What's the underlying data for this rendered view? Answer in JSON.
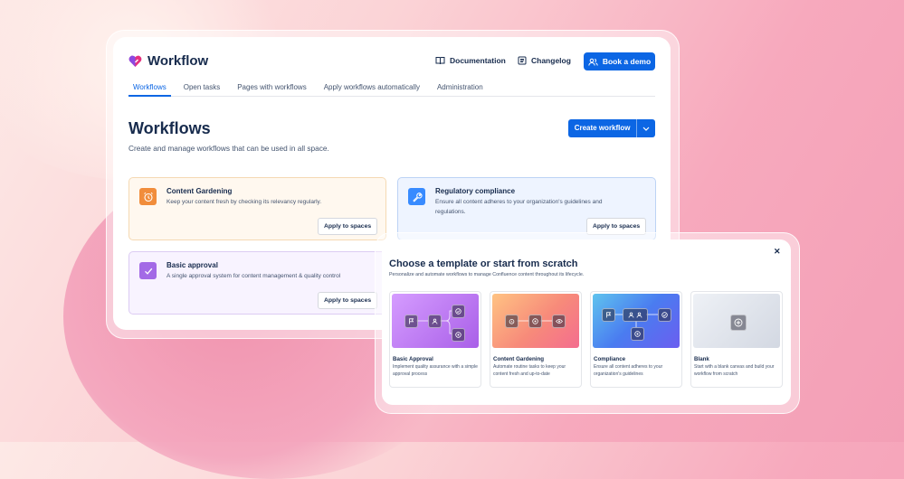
{
  "app": {
    "name": "Workflow"
  },
  "header": {
    "documentation": "Documentation",
    "changelog": "Changelog",
    "book_demo": "Book a demo"
  },
  "tabs": [
    {
      "label": "Workflows",
      "active": true
    },
    {
      "label": "Open tasks"
    },
    {
      "label": "Pages with workflows"
    },
    {
      "label": "Apply workflows automatically"
    },
    {
      "label": "Administration"
    }
  ],
  "page": {
    "title": "Workflows",
    "subtitle": "Create and manage workflows that can be used in all space.",
    "create_button": "Create workflow"
  },
  "workflows": [
    {
      "title": "Content Gardening",
      "description": "Keep your content fresh by checking its relevancy regularly.",
      "action": "Apply to spaces",
      "icon": "alarm-clock-icon",
      "accent": "#f18d3b"
    },
    {
      "title": "Regulatory compliance",
      "description": "Ensure all content adheres to your organization's guidelines and regulations.",
      "action": "Apply to spaces",
      "icon": "wrench-icon",
      "accent": "#388bff"
    },
    {
      "title": "Basic approval",
      "description": "A single approval system for content management & quality control",
      "action": "Apply to spaces",
      "icon": "checkmark-icon",
      "accent": "#9f5fe0"
    }
  ],
  "modal": {
    "title": "Choose a template or start from scratch",
    "subtitle": "Personalize and automate workflows to manage Confluence content throughout its lifecycle.",
    "templates": [
      {
        "title": "Basic Approval",
        "description": "Implement quality assurance with a simple approval process"
      },
      {
        "title": "Content Gardening",
        "description": "Automate routine tasks to keep your content fresh and up-to-date"
      },
      {
        "title": "Compliance",
        "description": "Ensure all content adheres to your organization's guidelines"
      },
      {
        "title": "Blank",
        "description": "Start with a blank canvas and build your workflow from scratch"
      }
    ]
  },
  "colors": {
    "primary": "#0c66e4",
    "background_pink": "#f7a9bd"
  }
}
